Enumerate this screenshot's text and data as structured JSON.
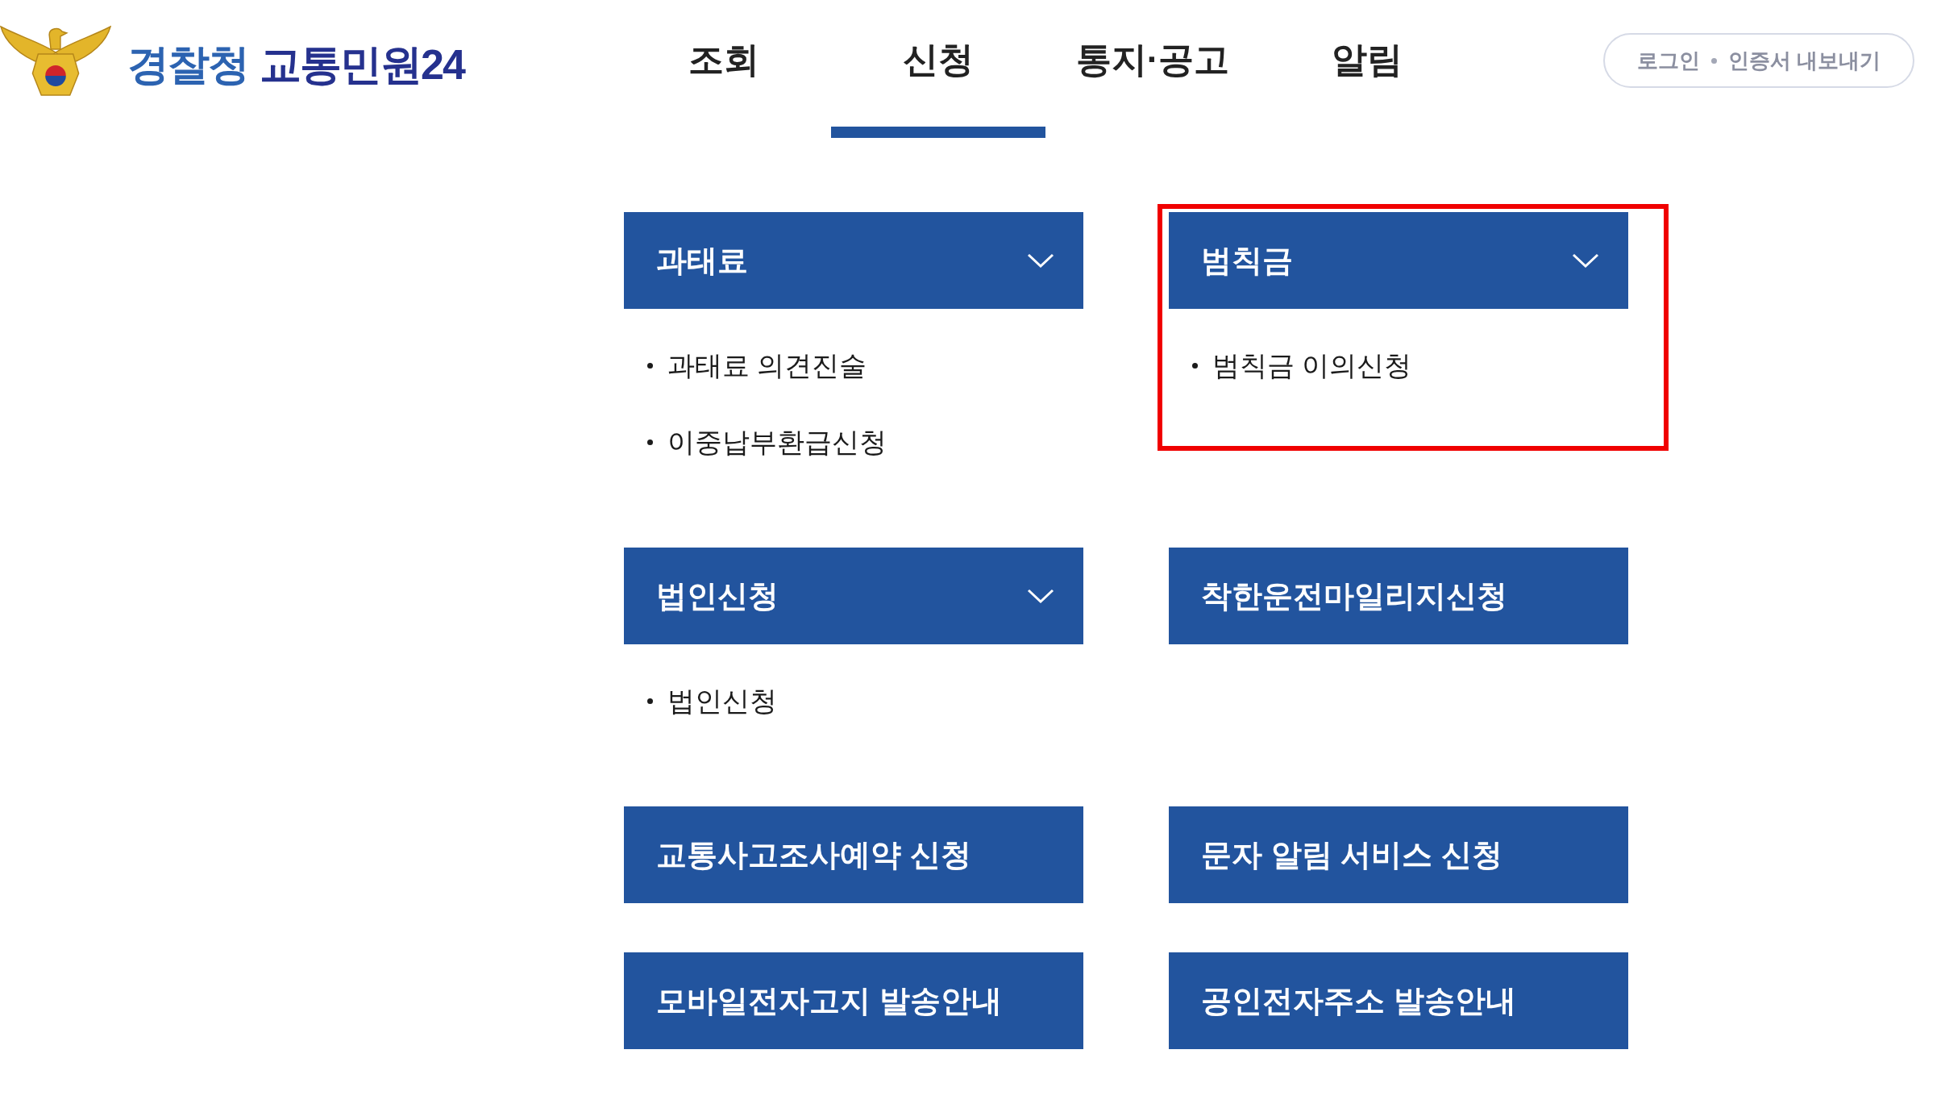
{
  "logo": {
    "org": "경찰청",
    "service": "교통민원24"
  },
  "nav": [
    {
      "label": "조회",
      "selected": false
    },
    {
      "label": "신청",
      "selected": true
    },
    {
      "label": "통지·공고",
      "selected": false
    },
    {
      "label": "알림",
      "selected": false
    }
  ],
  "account_bar": {
    "links": [
      "로그인",
      "인증서 내보내기"
    ]
  },
  "menu_panels": [
    {
      "title": "과태료",
      "kind": "dropdown",
      "highlighted": false,
      "items": [
        "과태료 의견진술",
        "이중납부환급신청"
      ]
    },
    {
      "title": "범칙금",
      "kind": "dropdown",
      "highlighted": true,
      "items": [
        "범칙금 이의신청"
      ]
    },
    {
      "title": "법인신청",
      "kind": "dropdown",
      "highlighted": false,
      "items": [
        "법인신청"
      ]
    },
    {
      "title": "착한운전마일리지신청",
      "kind": "link",
      "highlighted": false
    },
    {
      "title": "교통사고조사예약 신청",
      "kind": "link",
      "highlighted": false
    },
    {
      "title": "문자 알림 서비스 신청",
      "kind": "link",
      "highlighted": false
    },
    {
      "title": "모바일전자고지 발송안내",
      "kind": "link",
      "highlighted": false
    },
    {
      "title": "공인전자주소 발송안내",
      "kind": "link",
      "highlighted": false
    }
  ]
}
